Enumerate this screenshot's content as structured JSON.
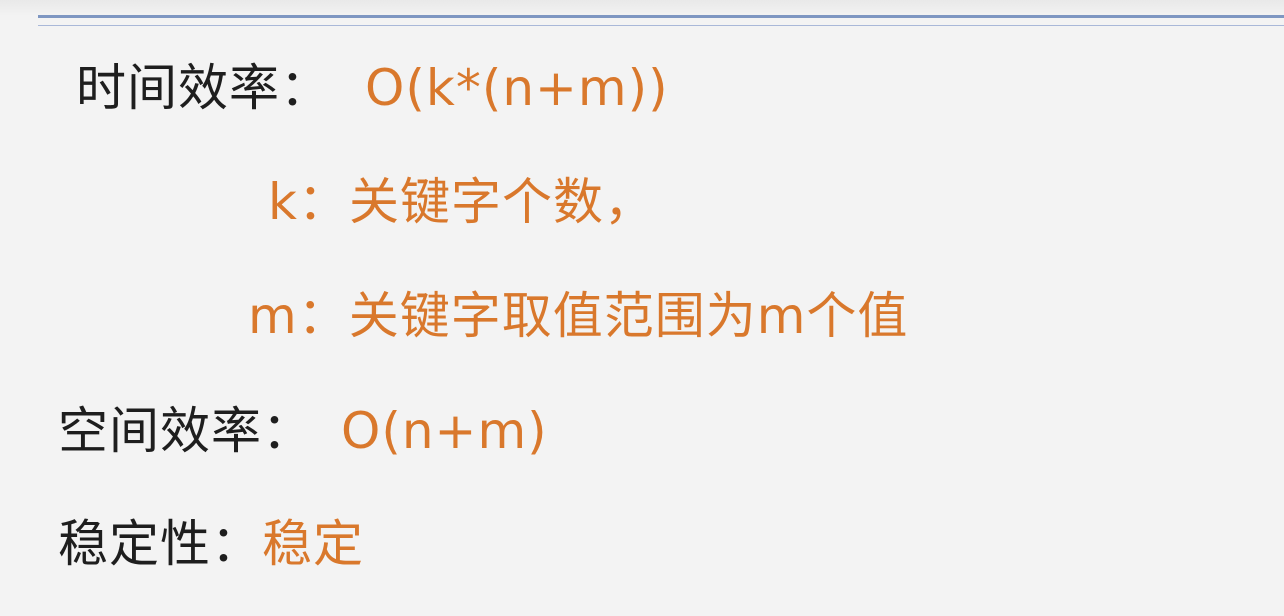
{
  "slide": {
    "time_label": "时间效率：",
    "time_value": "O(k*(n+m))",
    "k_label": "k：",
    "k_desc": "关键字个数，",
    "m_label": "m：",
    "m_desc": "关键字取值范围为m个值",
    "space_label": "空间效率：",
    "space_value": "O(n+m)",
    "stability_label": "稳定性：",
    "stability_value": "稳定"
  },
  "colors": {
    "text": "#1e1e1e",
    "accent": "#d9782c",
    "rule": "#7f97c2",
    "background": "#f3f3f3"
  }
}
